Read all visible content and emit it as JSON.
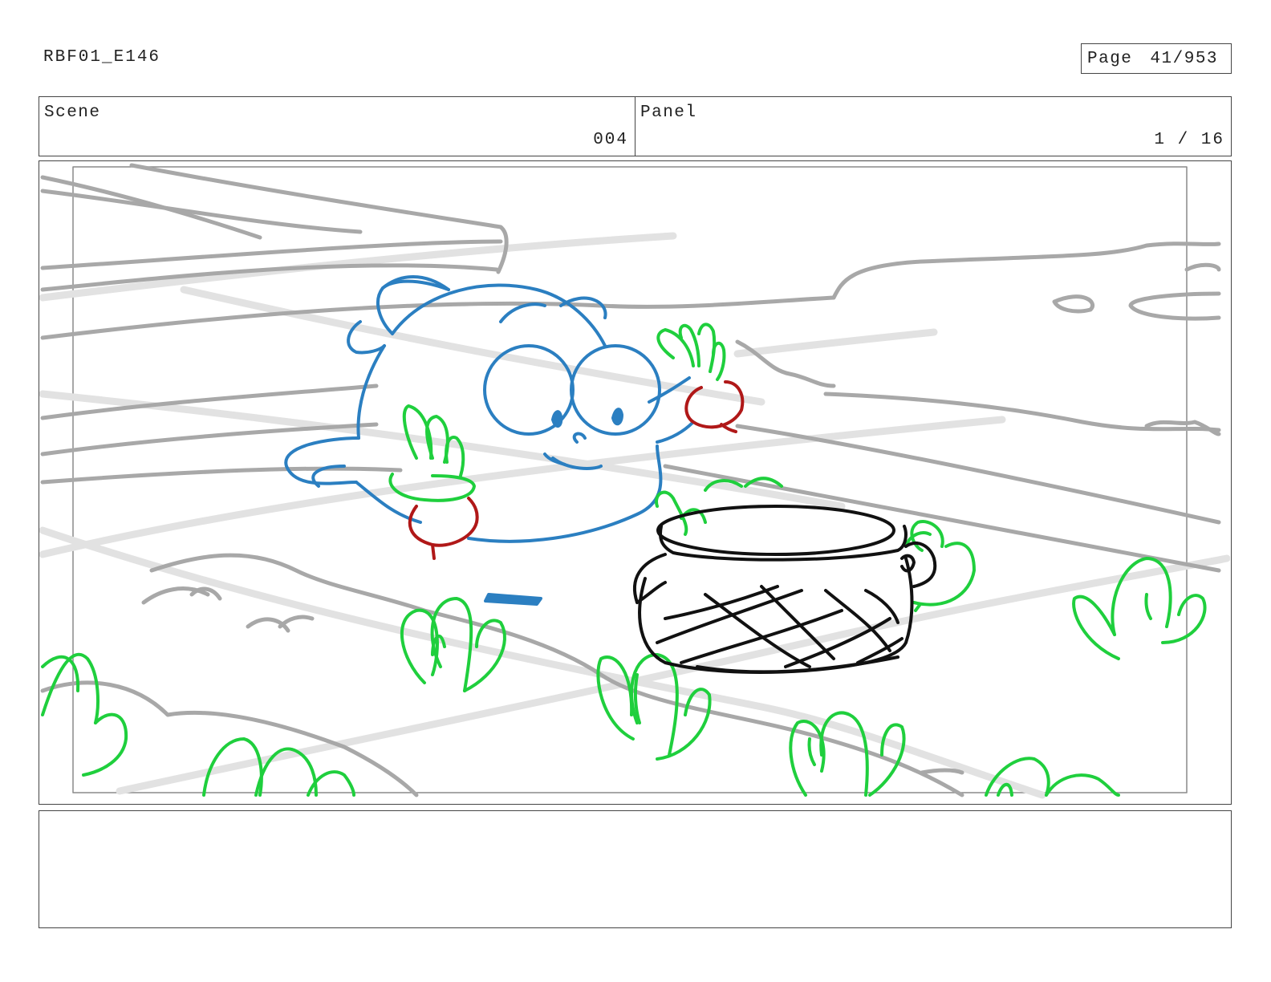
{
  "header": {
    "doc_id": "RBF01_E146",
    "page_label": "Page",
    "page_value": "41/953"
  },
  "scene": {
    "label": "Scene",
    "value": "004"
  },
  "panel": {
    "label": "Panel",
    "value": "1 / 16"
  },
  "drawing": {
    "description_icon": "storyboard-sketch",
    "colors": {
      "background_lines": "#a9a9a9",
      "light_lines": "#e3e3e3",
      "character": "#2b7fc1",
      "radish_leaves": "#1fcf3d",
      "radish_root": "#b01818",
      "basket": "#111111",
      "safe_frame": "#888888"
    }
  },
  "notes": {
    "text": ""
  }
}
